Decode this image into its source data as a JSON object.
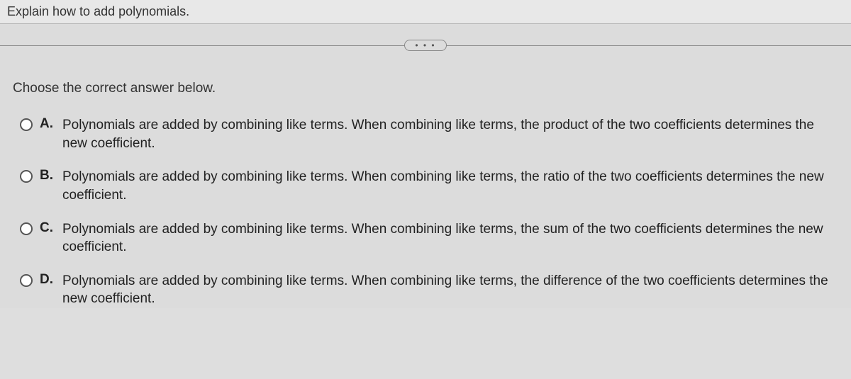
{
  "question": "Explain how to add polynomials.",
  "more_symbol": "• • •",
  "instruction": "Choose the correct answer below.",
  "options": [
    {
      "letter": "A.",
      "text": "Polynomials are added by combining like terms. When combining like terms, the product of the two coefficients determines the new coefficient."
    },
    {
      "letter": "B.",
      "text": "Polynomials are added by combining like terms. When combining like terms, the ratio of the two coefficients determines the new coefficient."
    },
    {
      "letter": "C.",
      "text": "Polynomials are added by combining like terms. When combining like terms, the sum of the two coefficients determines the new coefficient."
    },
    {
      "letter": "D.",
      "text": "Polynomials are added by combining like terms. When combining like terms, the difference of the two coefficients determines the new coefficient."
    }
  ]
}
